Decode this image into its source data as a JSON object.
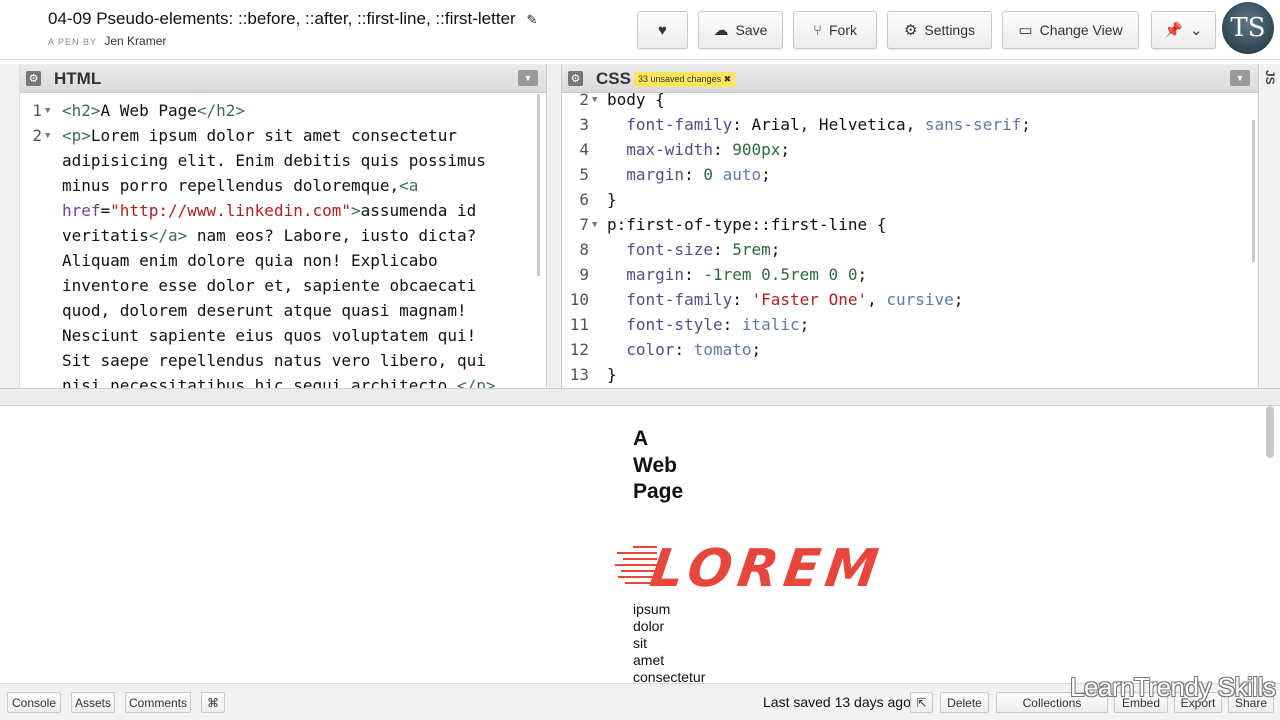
{
  "header": {
    "title": "04-09 Pseudo-elements: ::before, ::after, ::first-line, ::first-letter",
    "by_label": "A PEN BY",
    "author": "Jen Kramer",
    "buttons": {
      "save": "Save",
      "fork": "Fork",
      "settings": "Settings",
      "change_view": "Change View"
    },
    "avatar_text": "TS"
  },
  "html_editor": {
    "title": "HTML",
    "lines": [
      {
        "n": "1",
        "parts": [
          [
            "tag",
            "<h2>"
          ],
          [
            "txt",
            "A Web Page"
          ],
          [
            "tag",
            "</h2>"
          ]
        ]
      },
      {
        "n": "2",
        "parts": [
          [
            "tag",
            "<p>"
          ],
          [
            "txt",
            "Lorem ipsum dolor sit amet consectetur"
          ]
        ]
      },
      {
        "n": "",
        "parts": [
          [
            "txt",
            "adipisicing elit. Enim debitis quis possimus"
          ]
        ]
      },
      {
        "n": "",
        "parts": [
          [
            "txt",
            "minus porro repellendus doloremque,"
          ],
          [
            "tag",
            "<a"
          ]
        ]
      },
      {
        "n": "",
        "parts": [
          [
            "attr",
            "href"
          ],
          [
            "txt",
            "="
          ],
          [
            "str",
            "\"http://www.linkedin.com\""
          ],
          [
            "tag",
            ">"
          ],
          [
            "txt",
            "assumenda id"
          ]
        ]
      },
      {
        "n": "",
        "parts": [
          [
            "txt",
            "veritatis"
          ],
          [
            "tag",
            "</a>"
          ],
          [
            "txt",
            " nam eos? Labore, iusto dicta?"
          ]
        ]
      },
      {
        "n": "",
        "parts": [
          [
            "txt",
            "Aliquam enim dolore quia non! Explicabo"
          ]
        ]
      },
      {
        "n": "",
        "parts": [
          [
            "txt",
            "inventore esse dolor et, sapiente obcaecati"
          ]
        ]
      },
      {
        "n": "",
        "parts": [
          [
            "txt",
            "quod, dolorem deserunt atque quasi magnam!"
          ]
        ]
      },
      {
        "n": "",
        "parts": [
          [
            "txt",
            "Nesciunt sapiente eius quos voluptatem qui!"
          ]
        ]
      },
      {
        "n": "",
        "parts": [
          [
            "txt",
            "Sit saepe repellendus natus vero libero, qui"
          ]
        ]
      },
      {
        "n": "",
        "parts": [
          [
            "txt",
            "nisi necessitatibus hic sequi architecto."
          ],
          [
            "tag",
            "</p>"
          ]
        ]
      }
    ]
  },
  "css_editor": {
    "title": "CSS",
    "badge": "33 unsaved changes ✖",
    "lines": [
      {
        "n": "2",
        "fold": true,
        "parts": [
          [
            "txt",
            "body {"
          ]
        ]
      },
      {
        "n": "3",
        "parts": [
          [
            "txt",
            "  "
          ],
          [
            "prop",
            "font-family"
          ],
          [
            "txt",
            ": Arial, Helvetica, "
          ],
          [
            "kw",
            "sans-serif"
          ],
          [
            "txt",
            ";"
          ]
        ]
      },
      {
        "n": "4",
        "parts": [
          [
            "txt",
            "  "
          ],
          [
            "prop",
            "max-width"
          ],
          [
            "txt",
            ": "
          ],
          [
            "num",
            "900px"
          ],
          [
            "txt",
            ";"
          ]
        ]
      },
      {
        "n": "5",
        "parts": [
          [
            "txt",
            "  "
          ],
          [
            "prop",
            "margin"
          ],
          [
            "txt",
            ": "
          ],
          [
            "num",
            "0"
          ],
          [
            "txt",
            " "
          ],
          [
            "kw",
            "auto"
          ],
          [
            "txt",
            ";"
          ]
        ]
      },
      {
        "n": "6",
        "parts": [
          [
            "txt",
            "}"
          ]
        ]
      },
      {
        "n": "7",
        "fold": true,
        "parts": [
          [
            "txt",
            "p:first-of-type::first-line {"
          ]
        ]
      },
      {
        "n": "8",
        "parts": [
          [
            "txt",
            "  "
          ],
          [
            "prop",
            "font-size"
          ],
          [
            "txt",
            ": "
          ],
          [
            "num",
            "5rem"
          ],
          [
            "txt",
            ";"
          ]
        ]
      },
      {
        "n": "9",
        "parts": [
          [
            "txt",
            "  "
          ],
          [
            "prop",
            "margin"
          ],
          [
            "txt",
            ": "
          ],
          [
            "num",
            "-1rem 0.5rem 0 0"
          ],
          [
            "txt",
            ";"
          ]
        ]
      },
      {
        "n": "10",
        "parts": [
          [
            "txt",
            "  "
          ],
          [
            "prop",
            "font-family"
          ],
          [
            "txt",
            ": "
          ],
          [
            "str",
            "'Faster One'"
          ],
          [
            "txt",
            ", "
          ],
          [
            "kw",
            "cursive"
          ],
          [
            "txt",
            ";"
          ]
        ]
      },
      {
        "n": "11",
        "parts": [
          [
            "txt",
            "  "
          ],
          [
            "prop",
            "font-style"
          ],
          [
            "txt",
            ": "
          ],
          [
            "kw",
            "italic"
          ],
          [
            "txt",
            ";"
          ]
        ]
      },
      {
        "n": "12",
        "parts": [
          [
            "txt",
            "  "
          ],
          [
            "prop",
            "color"
          ],
          [
            "txt",
            ": "
          ],
          [
            "kw",
            "tomato"
          ],
          [
            "txt",
            ";"
          ]
        ]
      },
      {
        "n": "13",
        "parts": [
          [
            "txt",
            "}"
          ]
        ]
      }
    ]
  },
  "js_tab": "JS",
  "preview": {
    "heading_lines": [
      "A",
      "Web",
      "Page"
    ],
    "first_line_word": "LOREM",
    "words": [
      "ipsum",
      "dolor",
      "sit",
      "amet",
      "consectetur"
    ],
    "accent_color": "#e8453c"
  },
  "footer": {
    "console": "Console",
    "assets": "Assets",
    "comments": "Comments",
    "shortcut": "⌘",
    "last_saved": "Last saved 13 days ago",
    "delete": "Delete",
    "collections": "Collections",
    "embed": "Embed",
    "export": "Export",
    "share": "Share"
  },
  "watermark": "LearnTrendy Skills"
}
